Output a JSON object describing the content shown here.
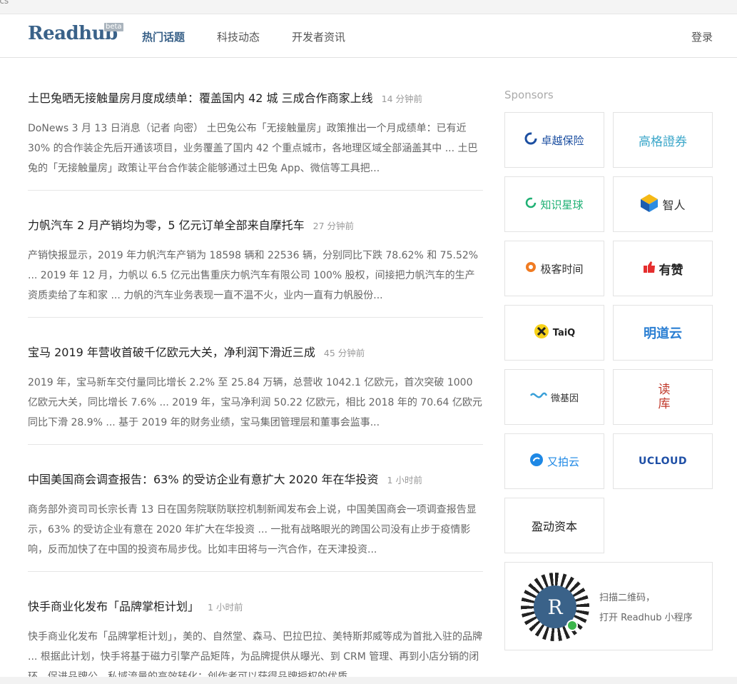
{
  "browser": {
    "tab_fragment": "ics"
  },
  "header": {
    "logo": "Readhub",
    "beta": "beta",
    "nav": [
      "热门话题",
      "科技动态",
      "开发者资讯"
    ],
    "login": "登录"
  },
  "news": [
    {
      "title": "土巴兔晒无接触量房月度成绩单：覆盖国内 42 城 三成合作商家上线",
      "time": "14 分钟前",
      "summary": "DoNews 3 月 13 日消息（记者 向密） 土巴兔公布「无接触量房」政策推出一个月成绩单：已有近 30% 的合作装企先后开通该项目，业务覆盖了国内 42 个重点城市，各地理区域全部涵盖其中 ... 土巴兔的「无接触量房」政策让平台合作装企能够通过土巴兔 App、微信等工具把..."
    },
    {
      "title": "力帆汽车 2 月产销均为零，5 亿元订单全部来自摩托车",
      "time": "27 分钟前",
      "summary": "产销快报显示，2019 年力帆汽车产销为 18598 辆和 22536 辆，分别同比下跌 78.62% 和 75.52% ... 2019 年 12 月，力帆以 6.5 亿元出售重庆力帆汽车有限公司 100% 股权，间接把力帆汽车的生产资质卖给了车和家 ... 力帆的汽车业务表现一直不温不火，业内一直有力帆股份..."
    },
    {
      "title": "宝马 2019 年营收首破千亿欧元大关，净利润下滑近三成",
      "time": "45 分钟前",
      "summary": "2019 年，宝马新车交付量同比增长 2.2% 至 25.84 万辆，总营收 1042.1 亿欧元，首次突破 1000 亿欧元大关，同比增长 7.6% ... 2019 年，宝马净利润 50.22 亿欧元，相比 2018 年的 70.64 亿欧元同比下滑 28.9% ... 基于 2019 年的财务业绩，宝马集团管理层和董事会监事..."
    },
    {
      "title": "中国美国商会调查报告：63% 的受访企业有意扩大 2020 年在华投资",
      "time": "1 小时前",
      "summary": "商务部外资司司长宗长青 13 日在国务院联防联控机制新闻发布会上说，中国美国商会一项调查报告显示，63% 的受访企业有意在 2020 年扩大在华投资 ... 一批有战略眼光的跨国公司没有止步于疫情影响，反而加快了在中国的投资布局步伐。比如丰田将与一汽合作，在天津投资..."
    },
    {
      "title": "快手商业化发布「品牌掌柜计划」",
      "time": "1 小时前",
      "summary": "快手商业化发布「品牌掌柜计划」，美的、自然堂、森马、巴拉巴拉、美特斯邦威等成为首批入驻的品牌 ... 根据此计划，快手将基于磁力引擎产品矩阵，为品牌提供从曝光、到 CRM 管理、再到小店分销的闭环，促进品牌公、私域流量的高效转化；创作者可以获得品牌授权的优质..."
    }
  ],
  "sponsors": {
    "label": "Sponsors",
    "items": [
      {
        "name": "卓越保险",
        "color": "#1c4fa1",
        "icon": "c-ring-icon"
      },
      {
        "name": "高格證券",
        "color": "#3aa6c9",
        "icon": ""
      },
      {
        "name": "知识星球",
        "color": "#1fb074",
        "icon": "ring-icon"
      },
      {
        "name": "智人",
        "color": "#333333",
        "icon": "cube-icon"
      },
      {
        "name": "极客时间",
        "color": "#333333",
        "icon": "orange-q-icon"
      },
      {
        "name": "有赞",
        "color": "#222222",
        "icon": "thumb-icon"
      },
      {
        "name": "TaiQ",
        "color": "#222222",
        "icon": "yellow-circle-icon"
      },
      {
        "name": "明道云",
        "color": "#2b7fd3",
        "icon": ""
      },
      {
        "name": "微基因",
        "color": "#333333",
        "icon": "dna-icon"
      },
      {
        "name": "读库",
        "color": "#c0392b",
        "icon": ""
      },
      {
        "name": "又拍云",
        "color": "#1e88e5",
        "icon": "cloud-icon"
      },
      {
        "name": "UCLOUD",
        "color": "#1e4fa6",
        "icon": ""
      },
      {
        "name": "盈动资本",
        "color": "#222222",
        "icon": ""
      }
    ]
  },
  "miniprogram": {
    "line1": "扫描二维码，",
    "line2": "打开 Readhub 小程序",
    "avatar": "R"
  }
}
